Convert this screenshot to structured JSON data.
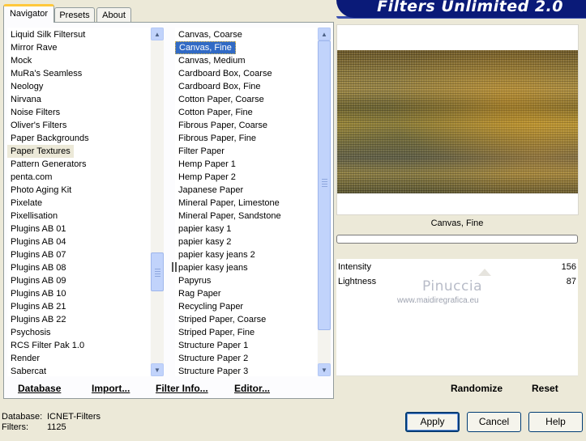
{
  "header": {
    "title": "Filters Unlimited 2.0"
  },
  "tabs": [
    {
      "label": "Navigator",
      "active": true
    },
    {
      "label": "Presets",
      "active": false
    },
    {
      "label": "About",
      "active": false
    }
  ],
  "categories": {
    "items": [
      "Liquid Silk Filtersut",
      "Mirror Rave",
      "Mock",
      "MuRa's Seamless",
      "Neology",
      "Nirvana",
      "Noise Filters",
      "Oliver's Filters",
      "Paper Backgrounds",
      "Paper Textures",
      "Pattern Generators",
      "penta.com",
      "Photo Aging Kit",
      "Pixelate",
      "Pixellisation",
      "Plugins AB 01",
      "Plugins AB 04",
      "Plugins AB 07",
      "Plugins AB 08",
      "Plugins AB 09",
      "Plugins AB 10",
      "Plugins AB 21",
      "Plugins AB 22",
      "Psychosis",
      "RCS Filter Pak 1.0",
      "Render",
      "Sabercat"
    ],
    "selected": "Paper Textures"
  },
  "filters": {
    "items": [
      "Canvas, Coarse",
      "Canvas, Fine",
      "Canvas, Medium",
      "Cardboard Box, Coarse",
      "Cardboard Box, Fine",
      "Cotton Paper, Coarse",
      "Cotton Paper, Fine",
      "Fibrous Paper, Coarse",
      "Fibrous Paper, Fine",
      "Filter Paper",
      "Hemp Paper 1",
      "Hemp Paper 2",
      "Japanese Paper",
      "Mineral Paper, Limestone",
      "Mineral Paper, Sandstone",
      "papier kasy 1",
      "papier kasy 2",
      "papier kasy jeans 2",
      "papier kasy jeans",
      "Papyrus",
      "Rag Paper",
      "Recycling Paper",
      "Striped Paper, Coarse",
      "Striped Paper, Fine",
      "Structure Paper 1",
      "Structure Paper 2",
      "Structure Paper 3"
    ],
    "selected": "Canvas, Fine"
  },
  "left_links": {
    "database": "Database",
    "import": "Import...",
    "filter_info": "Filter Info...",
    "editor": "Editor..."
  },
  "preview": {
    "filter_name": "Canvas, Fine"
  },
  "params": [
    {
      "label": "Intensity",
      "value": "156"
    },
    {
      "label": "Lightness",
      "value": "87"
    }
  ],
  "watermark": {
    "name": "Pinuccia",
    "site": "www.maidiregrafica.eu"
  },
  "right_links": {
    "randomize": "Randomize",
    "reset": "Reset"
  },
  "status": {
    "database_label": "Database:",
    "database_value": "ICNET-Filters",
    "filters_label": "Filters:",
    "filters_value": "1125"
  },
  "buttons": {
    "apply": "Apply",
    "cancel": "Cancel",
    "help": "Help"
  },
  "colors": {
    "banner": "#0A1A78",
    "selection": "#316AC5",
    "tab_highlight": "#FFC83C"
  }
}
